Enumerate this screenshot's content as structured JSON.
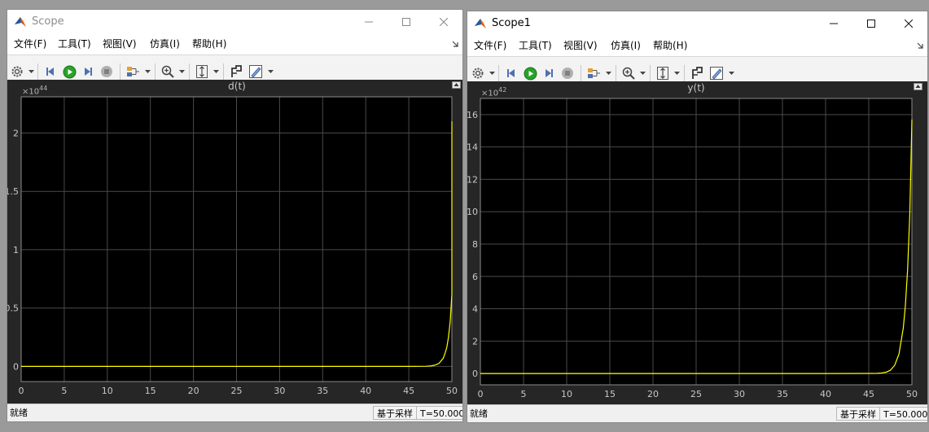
{
  "menus": [
    "文件(F)",
    "工具(T)",
    "视图(V)",
    "仿真(I)",
    "帮助(H)"
  ],
  "colors": {
    "plot_background": "#262626",
    "axes_background": "#000000",
    "grid": "#4a4a4a",
    "axes_text": "#c8c8c8",
    "signal": "#ffff00",
    "play_button": "#22a022"
  },
  "toolbar_icons": [
    "settings-icon",
    "step-back-icon",
    "run-icon",
    "step-forward-icon",
    "stop-icon",
    "signal-select-icon",
    "zoom-icon",
    "autoscale-icon",
    "cursor-measure-icon",
    "highlight-icon"
  ],
  "windows": [
    {
      "title": "Scope",
      "active": false,
      "exponent_base": "×10",
      "exponent_power": "44",
      "status_text": "就绪",
      "sample_mode": "基于采样",
      "time_display": "T=50.000",
      "chart_data": {
        "type": "line",
        "title": "d(t)",
        "xlabel": "",
        "ylabel": "",
        "xlim": [
          0,
          50
        ],
        "ylim": [
          -0.13,
          2.31
        ],
        "x_ticks": [
          "0",
          "5",
          "10",
          "15",
          "20",
          "25",
          "30",
          "35",
          "40",
          "45",
          "50"
        ],
        "y_ticks": [
          "0",
          "0.5",
          "1",
          "1.5",
          "2"
        ],
        "y_tick_values": [
          0,
          0.5,
          1,
          1.5,
          2
        ],
        "y_scale_factor": "1e44",
        "grid": true,
        "series": [
          {
            "color": "#ffff00",
            "x": [
              0,
              40,
              45,
              46,
              47,
              47.5,
              48,
              48.5,
              49,
              49.2,
              49.4,
              49.6,
              49.8,
              50,
              50,
              50,
              50
            ],
            "y": [
              0,
              0,
              0,
              0.0001,
              0.001,
              0.003,
              0.01,
              0.025,
              0.07,
              0.11,
              0.16,
              0.25,
              0.38,
              0.62,
              1.4,
              1.7,
              2.1
            ]
          }
        ]
      }
    },
    {
      "title": "Scope1",
      "active": true,
      "exponent_base": "×10",
      "exponent_power": "42",
      "status_text": "就绪",
      "sample_mode": "基于采样",
      "time_display": "T=50.000",
      "chart_data": {
        "type": "line",
        "title": "y(t)",
        "xlabel": "",
        "ylabel": "",
        "xlim": [
          0,
          50
        ],
        "ylim": [
          -0.7,
          17.0
        ],
        "x_ticks": [
          "0",
          "5",
          "10",
          "15",
          "20",
          "25",
          "30",
          "35",
          "40",
          "45",
          "50"
        ],
        "y_ticks": [
          "0",
          "2",
          "4",
          "6",
          "8",
          "10",
          "12",
          "14",
          "16"
        ],
        "y_tick_values": [
          0,
          2,
          4,
          6,
          8,
          10,
          12,
          14,
          16
        ],
        "y_scale_factor": "1e42",
        "grid": true,
        "series": [
          {
            "color": "#ffff00",
            "x": [
              0,
              40,
              45,
              46,
              46.5,
              47,
              47.5,
              48,
              48.5,
              49,
              49.25,
              49.5,
              49.75,
              50
            ],
            "y": [
              0,
              0,
              0.002,
              0.01,
              0.03,
              0.08,
              0.2,
              0.5,
              1.2,
              2.8,
              4.2,
              6.4,
              9.8,
              15.7
            ]
          }
        ]
      }
    }
  ]
}
